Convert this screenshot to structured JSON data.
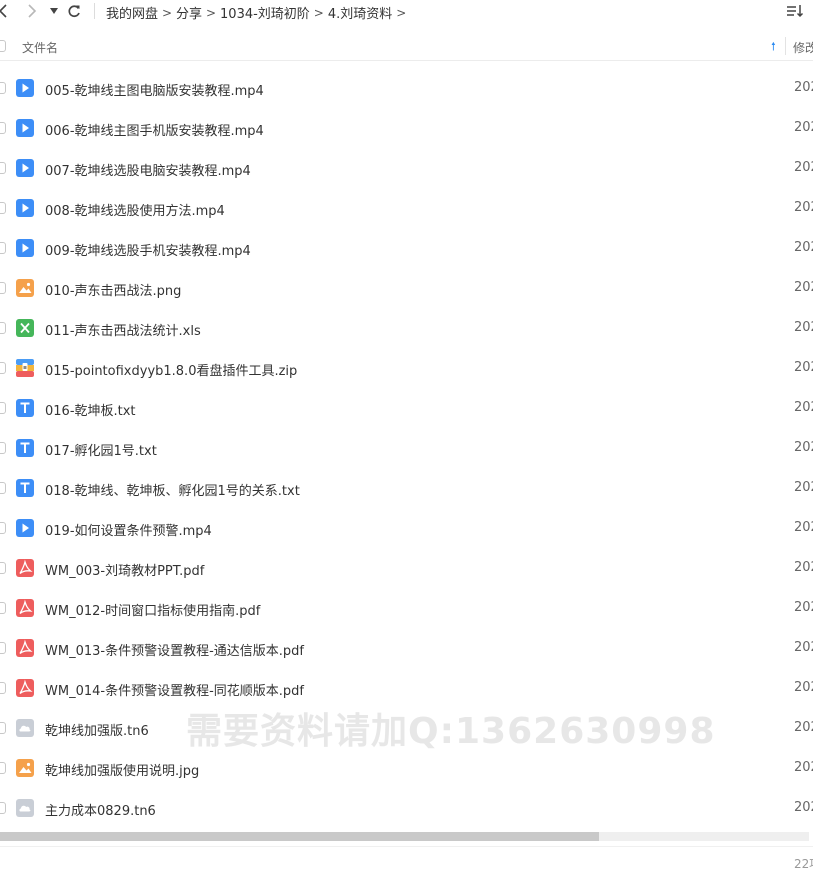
{
  "breadcrumb": [
    "我的网盘",
    "分享",
    "1034-刘琦初阶",
    "4.刘琦资料"
  ],
  "columns": {
    "name": "文件名",
    "modified": "修改"
  },
  "files": [
    {
      "name": "005-乾坤线主图电脑版安装教程.mp4",
      "type": "video",
      "date": "202"
    },
    {
      "name": "006-乾坤线主图手机版安装教程.mp4",
      "type": "video",
      "date": "202"
    },
    {
      "name": "007-乾坤线选股电脑安装教程.mp4",
      "type": "video",
      "date": "202"
    },
    {
      "name": "008-乾坤线选股使用方法.mp4",
      "type": "video",
      "date": "202"
    },
    {
      "name": "009-乾坤线选股手机安装教程.mp4",
      "type": "video",
      "date": "202"
    },
    {
      "name": "010-声东击西战法.png",
      "type": "image",
      "date": "202"
    },
    {
      "name": "011-声东击西战法统计.xls",
      "type": "excel",
      "date": "202"
    },
    {
      "name": "015-pointofixdyyb1.8.0看盘插件工具.zip",
      "type": "zip",
      "date": "202"
    },
    {
      "name": "016-乾坤板.txt",
      "type": "text",
      "date": "202"
    },
    {
      "name": "017-孵化园1号.txt",
      "type": "text",
      "date": "202"
    },
    {
      "name": "018-乾坤线、乾坤板、孵化园1号的关系.txt",
      "type": "text",
      "date": "202"
    },
    {
      "name": "019-如何设置条件预警.mp4",
      "type": "video",
      "date": "202"
    },
    {
      "name": "WM_003-刘琦教材PPT.pdf",
      "type": "pdf",
      "date": "202"
    },
    {
      "name": "WM_012-时间窗口指标使用指南.pdf",
      "type": "pdf",
      "date": "202"
    },
    {
      "name": "WM_013-条件预警设置教程-通达信版本.pdf",
      "type": "pdf",
      "date": "202"
    },
    {
      "name": "WM_014-条件预警设置教程-同花顺版本.pdf",
      "type": "pdf",
      "date": "202"
    },
    {
      "name": "乾坤线加强版.tn6",
      "type": "unknown",
      "date": "202"
    },
    {
      "name": "乾坤线加强版使用说明.jpg",
      "type": "image",
      "date": "202"
    },
    {
      "name": "主力成本0829.tn6",
      "type": "unknown",
      "date": "202"
    }
  ],
  "watermark": "需要资料请加Q:1362630998",
  "footer": {
    "count": "22"
  },
  "scroll": {
    "horizontal_thumb_fraction": 0.74
  },
  "colors": {
    "video": "#3d8ef7",
    "image": "#f5a14b",
    "excel": "#45b65a",
    "text": "#3d8ef7",
    "pdf": "#ee5d5d",
    "unknown": "#c9ced6",
    "accent": "#2b8bf2"
  },
  "icons": {
    "video": "video-file-icon",
    "image": "image-file-icon",
    "excel": "excel-file-icon",
    "zip": "zip-file-icon",
    "text": "text-file-icon",
    "pdf": "pdf-file-icon",
    "unknown": "unknown-file-icon"
  }
}
